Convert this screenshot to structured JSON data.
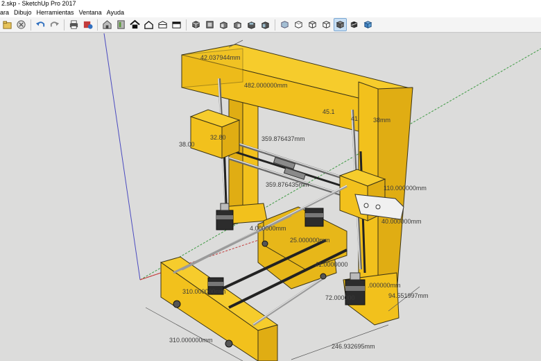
{
  "window": {
    "title": "2.skp - SketchUp Pro 2017"
  },
  "menu": {
    "items": [
      {
        "label": "ara"
      },
      {
        "label": "Dibujo"
      },
      {
        "label": "Herramientas"
      },
      {
        "label": "Ventana"
      },
      {
        "label": "Ayuda"
      }
    ]
  },
  "toolbar": {
    "groups": [
      [
        "open-icon",
        "erase-icon",
        "undo-icon",
        "redo-icon",
        "print-icon",
        "model-info-icon"
      ],
      [
        "warehouse-icon",
        "component-icon",
        "home-icon",
        "house-outline-icon",
        "extension-icon",
        "send-layout-icon"
      ],
      [
        "view-iso-icon",
        "view-top-icon",
        "view-front-icon",
        "view-right-icon",
        "view-back-icon",
        "view-left-icon"
      ],
      [
        "xray-icon",
        "back-edges-icon",
        "wireframe-icon",
        "hidden-line-icon",
        "shaded-icon",
        "shaded-textures-icon",
        "monochrome-icon"
      ]
    ],
    "active": "shaded-icon"
  },
  "colors": {
    "frame": "#f2c11c",
    "frame_edge": "#3b3416",
    "background": "#dcdcdb",
    "axis_red": "#c23b3b",
    "axis_green": "#3e9a43",
    "axis_blue": "#4a4ac0"
  },
  "dimensions": {
    "d1": "42.037944mm",
    "d2": "482.000000mm",
    "d3": "45.1",
    "d4": "41",
    "d5": "38mm",
    "d6": "32.80",
    "d7": "38.00",
    "d8": "359.876437mm",
    "d9": "359.876435mm",
    "d10": "110.000000mm",
    "d11": "40.000000mm",
    "d12": "25.000000mm",
    "d13": "4.000000mm",
    "d14": "41.0000000",
    "d15": "310.000000mm",
    "d16": "72.000000",
    "d17": ".000000mm",
    "d18": "94.551997mm",
    "d19": "310.000000mm",
    "d20": "246.932695mm"
  }
}
